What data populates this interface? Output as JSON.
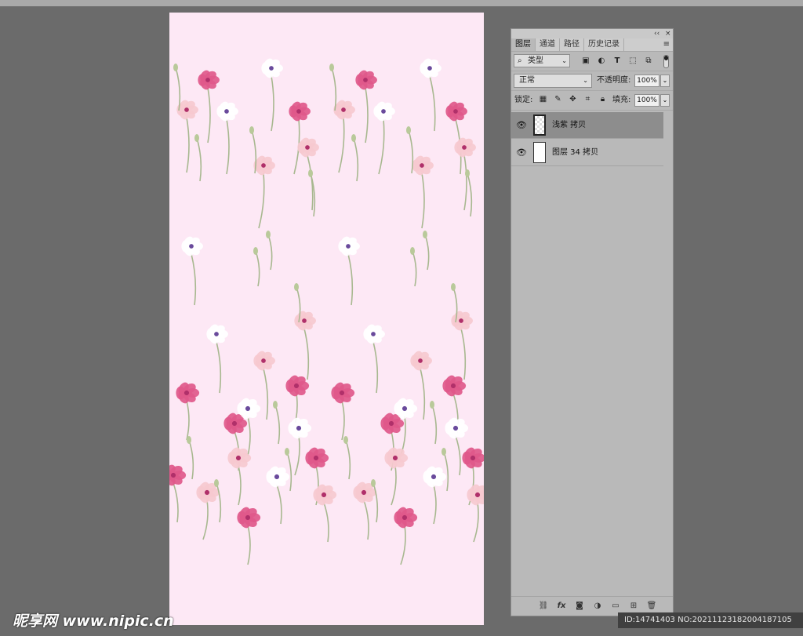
{
  "panel": {
    "collapse_glyph": "‹‹",
    "close_glyph": "×",
    "tabs": [
      {
        "label": "图层"
      },
      {
        "label": "通道"
      },
      {
        "label": "路径"
      },
      {
        "label": "历史记录"
      }
    ],
    "menu_icon": "panel-menu-icon",
    "filter": {
      "search_glyph": "🔍",
      "label": "类型",
      "icons": [
        "image-filter-icon",
        "adjustment-filter-icon",
        "text-filter-icon",
        "shape-filter-icon",
        "smart-object-filter-icon"
      ]
    },
    "blend_mode": "正常",
    "opacity_label": "不透明度:",
    "opacity_value": "100%",
    "lock_label": "锁定:",
    "fill_label": "填充:",
    "fill_value": "100%",
    "layers": [
      {
        "name": "浅紫 拷贝",
        "selected": true,
        "visible": true
      },
      {
        "name": "图层 34 拷贝",
        "selected": false,
        "visible": true
      }
    ],
    "bottom_icons": [
      "link-layers-icon",
      "fx-icon",
      "add-mask-icon",
      "adjustment-layer-icon",
      "new-group-icon",
      "new-layer-icon",
      "delete-layer-icon"
    ]
  },
  "document": {
    "background": "#fde8f5"
  },
  "watermark": {
    "site": "昵享网 www.nipic.cn",
    "id_text": "ID:14741403 NO:20211123182004187105"
  },
  "colors": {
    "app_bg": "#6b6b6b",
    "panel_bg": "#b9b9b9",
    "poppy_red": "#e0588a",
    "poppy_pink": "#f6c9cf",
    "anemone_white": "#ffffff",
    "anemone_center": "#6a4a9c",
    "stem": "#a8b890"
  }
}
